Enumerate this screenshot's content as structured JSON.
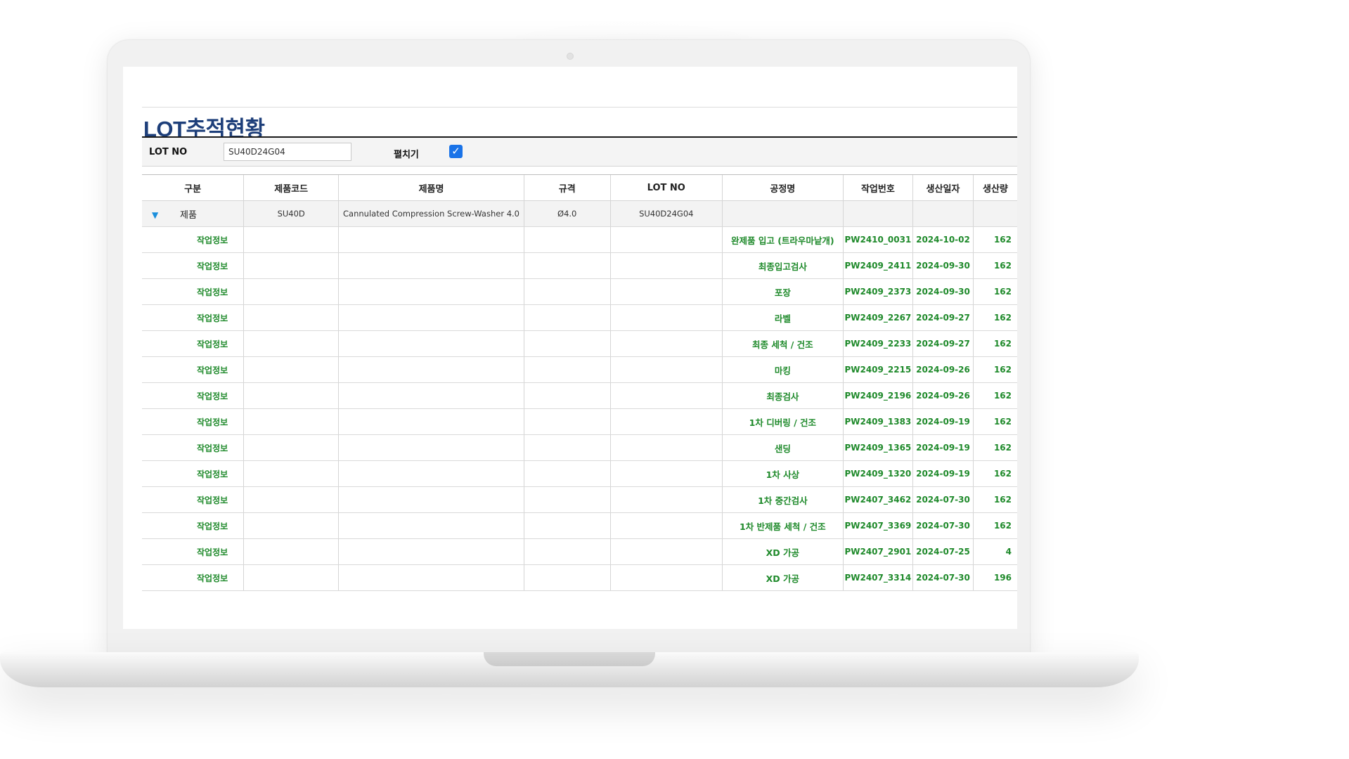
{
  "page": {
    "title": "LOT추적현황",
    "filters": {
      "lot_label": "LOT NO",
      "lot_value": "SU40D24G04",
      "expand_label": "펼치기",
      "expand_checked": true
    }
  },
  "table": {
    "columns": [
      "구분",
      "제품코드",
      "제품명",
      "규격",
      "LOT NO",
      "공정명",
      "작업번호",
      "생산일자",
      "생산량"
    ],
    "product_row": {
      "gubun": "제품",
      "code": "SU40D",
      "name": "Cannulated Compression Screw-Washer 4.0",
      "spec": "Ø4.0",
      "lot": "SU40D24G04"
    },
    "work_rows": [
      {
        "gubun": "작업정보",
        "process": "완제품 입고 (트라우마낱개)",
        "work_no": "PW2410_0031",
        "date": "2024-10-02",
        "qty": "162"
      },
      {
        "gubun": "작업정보",
        "process": "최종입고검사",
        "work_no": "PW2409_2411",
        "date": "2024-09-30",
        "qty": "162"
      },
      {
        "gubun": "작업정보",
        "process": "포장",
        "work_no": "PW2409_2373",
        "date": "2024-09-30",
        "qty": "162"
      },
      {
        "gubun": "작업정보",
        "process": "라벨",
        "work_no": "PW2409_2267",
        "date": "2024-09-27",
        "qty": "162"
      },
      {
        "gubun": "작업정보",
        "process": "최종 세척 / 건조",
        "work_no": "PW2409_2233",
        "date": "2024-09-27",
        "qty": "162"
      },
      {
        "gubun": "작업정보",
        "process": "마킹",
        "work_no": "PW2409_2215",
        "date": "2024-09-26",
        "qty": "162"
      },
      {
        "gubun": "작업정보",
        "process": "최종검사",
        "work_no": "PW2409_2196",
        "date": "2024-09-26",
        "qty": "162"
      },
      {
        "gubun": "작업정보",
        "process": "1차 디버링 / 건조",
        "work_no": "PW2409_1383",
        "date": "2024-09-19",
        "qty": "162"
      },
      {
        "gubun": "작업정보",
        "process": "샌딩",
        "work_no": "PW2409_1365",
        "date": "2024-09-19",
        "qty": "162"
      },
      {
        "gubun": "작업정보",
        "process": "1차 사상",
        "work_no": "PW2409_1320",
        "date": "2024-09-19",
        "qty": "162"
      },
      {
        "gubun": "작업정보",
        "process": "1차 중간검사",
        "work_no": "PW2407_3462",
        "date": "2024-07-30",
        "qty": "162"
      },
      {
        "gubun": "작업정보",
        "process": "1차 반제품 세척 / 건조",
        "work_no": "PW2407_3369",
        "date": "2024-07-30",
        "qty": "162"
      },
      {
        "gubun": "작업정보",
        "process": "XD 가공",
        "work_no": "PW2407_2901",
        "date": "2024-07-25",
        "qty": "4"
      },
      {
        "gubun": "작업정보",
        "process": "XD 가공",
        "work_no": "PW2407_3314",
        "date": "2024-07-30",
        "qty": "196"
      }
    ]
  },
  "colors": {
    "title": "#1e3f7a",
    "work_text": "#1f8a2b",
    "checkbox": "#1a73e8",
    "expand_icon": "#1a8fdc"
  },
  "icons": {
    "expand": "caret-down-icon",
    "checkbox": "check-icon"
  }
}
